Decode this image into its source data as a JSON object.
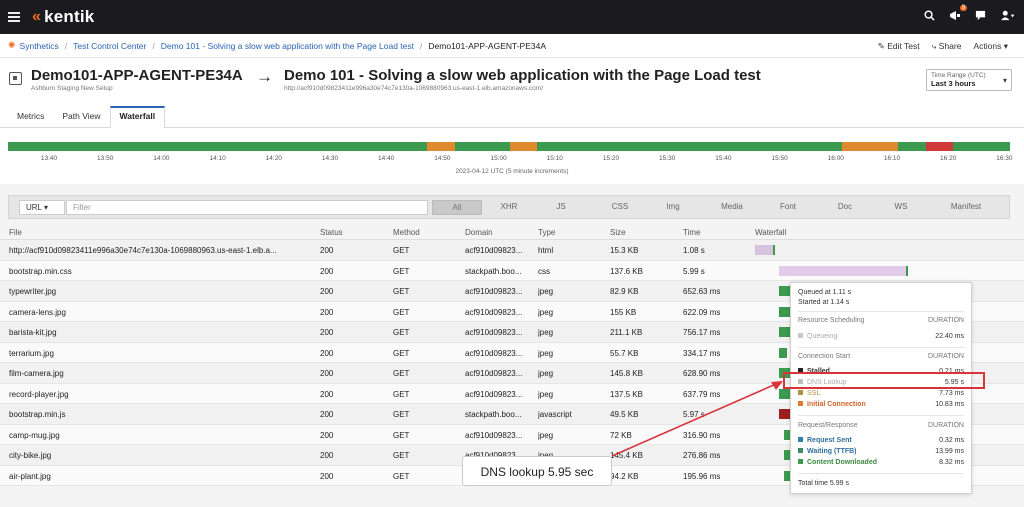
{
  "topbar": {
    "logo_text": "kentik",
    "notification_count": "9"
  },
  "breadcrumb": {
    "items": [
      "Synthetics",
      "Test Control Center",
      "Demo 101 - Solving a slow web application with the Page Load test"
    ],
    "current": "Demo101-APP-AGENT-PE34A",
    "edit_label": "Edit Test",
    "share_label": "Share",
    "actions_label": "Actions"
  },
  "header": {
    "agent_name": "Demo101-APP-AGENT-PE34A",
    "agent_location": "Ashburn Staging New Setup",
    "test_name": "Demo 101 - Solving a slow web application with the Page Load test",
    "test_url": "http://acf910d09823411e996a30e74c7e130a-1069880963.us-east-1.elb.amazonaws.com/",
    "time_range_label": "Time Range (UTC)",
    "time_range_value": "Last 3 hours"
  },
  "tabs": [
    {
      "label": "Metrics",
      "active": false
    },
    {
      "label": "Path View",
      "active": false
    },
    {
      "label": "Waterfall",
      "active": true
    }
  ],
  "timeline": {
    "ticks": [
      "13:40",
      "13:50",
      "14:00",
      "14:10",
      "14:20",
      "14:30",
      "14:40",
      "14:50",
      "15:00",
      "15:10",
      "15:20",
      "15:30",
      "15:40",
      "15:50",
      "16:00",
      "16:10",
      "16:20",
      "16:30"
    ],
    "caption": "2023-04-12 UTC (5 minute increments)",
    "segments": [
      {
        "status": "healthy",
        "color": "#3b9a4f",
        "span": 0.418
      },
      {
        "status": "warning",
        "color": "#e08a2e",
        "span": 0.028
      },
      {
        "status": "healthy",
        "color": "#3b9a4f",
        "span": 0.055
      },
      {
        "status": "warning",
        "color": "#e08a2e",
        "span": 0.027
      },
      {
        "status": "healthy",
        "color": "#3b9a4f",
        "span": 0.304
      },
      {
        "status": "warning",
        "color": "#e08a2e",
        "span": 0.056
      },
      {
        "status": "healthy",
        "color": "#3b9a4f",
        "span": 0.028
      },
      {
        "status": "critical",
        "color": "#d03a3a",
        "span": 0.027
      },
      {
        "status": "healthy",
        "color": "#3b9a4f",
        "span": 0.057
      }
    ]
  },
  "filter": {
    "url_select": "URL",
    "placeholder": "Filter",
    "types": [
      "All",
      "XHR",
      "JS",
      "CSS",
      "Img",
      "Media",
      "Font",
      "Doc",
      "WS",
      "Manifest"
    ],
    "active_type": "All"
  },
  "table": {
    "columns": [
      "File",
      "Status",
      "Method",
      "Domain",
      "Type",
      "Size",
      "Time",
      "Waterfall"
    ],
    "rows": [
      {
        "file": "http://acf910d09823411e996a30e74c7e130a-1069880963.us-east-1.elb.a...",
        "status": "200",
        "method": "GET",
        "domain": "acf910d09823...",
        "type": "html",
        "size": "15.3 KB",
        "time": "1.08 s"
      },
      {
        "file": "bootstrap.min.css",
        "status": "200",
        "method": "GET",
        "domain": "stackpath.boo...",
        "type": "css",
        "size": "137.6 KB",
        "time": "5.99 s"
      },
      {
        "file": "typewriter.jpg",
        "status": "200",
        "method": "GET",
        "domain": "acf910d09823...",
        "type": "jpeg",
        "size": "82.9 KB",
        "time": "652.63 ms"
      },
      {
        "file": "camera-lens.jpg",
        "status": "200",
        "method": "GET",
        "domain": "acf910d09823...",
        "type": "jpeg",
        "size": "155 KB",
        "time": "622.09 ms"
      },
      {
        "file": "barista-kit.jpg",
        "status": "200",
        "method": "GET",
        "domain": "acf910d09823...",
        "type": "jpeg",
        "size": "211.1 KB",
        "time": "756.17 ms"
      },
      {
        "file": "terrarium.jpg",
        "status": "200",
        "method": "GET",
        "domain": "acf910d09823...",
        "type": "jpeg",
        "size": "55.7 KB",
        "time": "334.17 ms"
      },
      {
        "file": "film-camera.jpg",
        "status": "200",
        "method": "GET",
        "domain": "acf910d09823...",
        "type": "jpeg",
        "size": "145.8 KB",
        "time": "628.90 ms"
      },
      {
        "file": "record-player.jpg",
        "status": "200",
        "method": "GET",
        "domain": "acf910d09823...",
        "type": "jpeg",
        "size": "137.5 KB",
        "time": "637.79 ms"
      },
      {
        "file": "bootstrap.min.js",
        "status": "200",
        "method": "GET",
        "domain": "stackpath.boo...",
        "type": "javascript",
        "size": "49.5 KB",
        "time": "5.97 s"
      },
      {
        "file": "camp-mug.jpg",
        "status": "200",
        "method": "GET",
        "domain": "acf910d09823...",
        "type": "jpeg",
        "size": "72 KB",
        "time": "316.90 ms"
      },
      {
        "file": "city-bike.jpg",
        "status": "200",
        "method": "GET",
        "domain": "acf910d09823...",
        "type": "jpeg",
        "size": "145.4 KB",
        "time": "276.86 ms"
      },
      {
        "file": "air-plant.jpg",
        "status": "200",
        "method": "GET",
        "domain": "acf910d09823...",
        "type": "jpeg",
        "size": "94.2 KB",
        "time": "195.96 ms"
      }
    ]
  },
  "tooltip": {
    "queued": "Queued at 1.11 s",
    "started": "Started at 1.14 s",
    "scheduling_header": "Resource Scheduling",
    "duration_label": "DURATION",
    "queueing_label": "Queueing",
    "queueing_value": "22.40 ms",
    "connection_header": "Connection Start",
    "stalled_label": "Stalled",
    "stalled_value": "0.21 ms",
    "dns_label": "DNS Lookup",
    "dns_value": "5.95 s",
    "ssl_label": "SSL",
    "ssl_value": "7.73 ms",
    "initial_label": "Initial Connection",
    "initial_value": "10.83 ms",
    "request_header": "Request/Response",
    "sent_label": "Request Sent",
    "sent_value": "0.32 ms",
    "waiting_label": "Waiting (TTFB)",
    "waiting_value": "13.99 ms",
    "download_label": "Content Downloaded",
    "download_value": "8.32 ms",
    "total": "Total time 5.99 s"
  },
  "callout": {
    "text": "DNS lookup 5.95 sec"
  }
}
